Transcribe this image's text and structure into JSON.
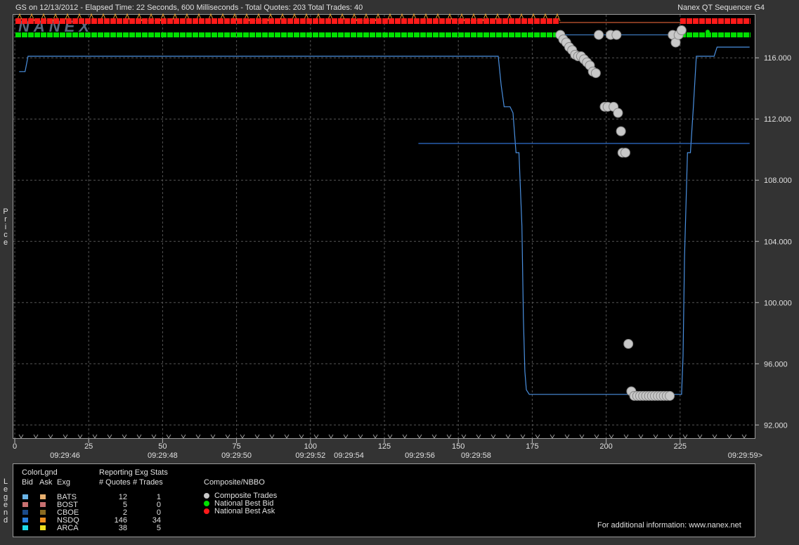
{
  "header": {
    "left_text": "GS on 12/13/2012  -  Elapsed Time: 22 Seconds, 600 Milliseconds  -  Total Quotes: 203  Total Trades: 40",
    "right_text": "Nanex QT Sequencer G4"
  },
  "watermark": "NANEX",
  "y_axis_label": "Price",
  "legend_side_label": "Legend",
  "chart_data": {
    "type": "scatter",
    "title": "",
    "ylim": [
      91.6,
      118.4
    ],
    "xlim": [
      0,
      250
    ],
    "y_ticks": [
      "92.000",
      "96.000",
      "100.000",
      "104.000",
      "108.000",
      "112.000",
      "116.000"
    ],
    "y_tick_values": [
      92,
      96,
      100,
      104,
      108,
      112,
      116
    ],
    "x_ticks": [
      "0",
      "25",
      "50",
      "75",
      "100",
      "125",
      "150",
      "175",
      "200",
      "225"
    ],
    "x_tick_values": [
      0,
      25,
      50,
      75,
      100,
      125,
      150,
      175,
      200,
      225
    ],
    "time_labels": [
      "09:29:46",
      "09:29:48",
      "09:29:50",
      "09:29:52",
      "09:29:54",
      "09:29:56",
      "09:29:58",
      "09:29:59>"
    ],
    "time_label_x": [
      17,
      50,
      75,
      100,
      113,
      137,
      156,
      247
    ],
    "grid": true,
    "series": [
      {
        "name": "Composite Trades",
        "color": "#c8c8c8",
        "points": [
          [
            184.5,
            117.5
          ],
          [
            185.5,
            117.2
          ],
          [
            186.5,
            117.0
          ],
          [
            187.5,
            116.7
          ],
          [
            188.5,
            116.5
          ],
          [
            189.5,
            116.2
          ],
          [
            190.5,
            116.1
          ],
          [
            191.5,
            116.1
          ],
          [
            192.5,
            115.9
          ],
          [
            193.5,
            115.7
          ],
          [
            194.5,
            115.5
          ],
          [
            195.5,
            115.1
          ],
          [
            196.5,
            115.0
          ],
          [
            197.5,
            117.5
          ],
          [
            199.5,
            112.8
          ],
          [
            200.5,
            112.8
          ],
          [
            201.5,
            117.5
          ],
          [
            202.5,
            112.8
          ],
          [
            203.5,
            117.5
          ],
          [
            204,
            112.4
          ],
          [
            205,
            111.2
          ],
          [
            205.5,
            109.8
          ],
          [
            206.5,
            109.8
          ],
          [
            207.5,
            97.3
          ],
          [
            208.5,
            94.2
          ],
          [
            209.5,
            93.9
          ],
          [
            210.5,
            93.9
          ],
          [
            211.5,
            93.9
          ],
          [
            212.5,
            93.9
          ],
          [
            213.5,
            93.9
          ],
          [
            214.5,
            93.9
          ],
          [
            215.5,
            93.9
          ],
          [
            216.5,
            93.9
          ],
          [
            217.5,
            93.9
          ],
          [
            218.5,
            93.9
          ],
          [
            219.5,
            93.9
          ],
          [
            220.5,
            93.9
          ],
          [
            221.5,
            93.9
          ],
          [
            222.5,
            117.5
          ],
          [
            223.5,
            117.0
          ],
          [
            224.5,
            117.5
          ],
          [
            225.5,
            117.8
          ]
        ]
      },
      {
        "name": "Light Blue Bid Line",
        "color": "#4a90e0",
        "line": [
          [
            1.5,
            115.1
          ],
          [
            3.5,
            115.1
          ],
          [
            4.5,
            116.1
          ],
          [
            163.5,
            116.1
          ],
          [
            164.5,
            114.2
          ],
          [
            165.5,
            112.8
          ],
          [
            167.5,
            112.8
          ],
          [
            168.5,
            112.4
          ],
          [
            169.5,
            109.8
          ],
          [
            170.5,
            109.8
          ],
          [
            171.5,
            105.0
          ],
          [
            172,
            99.0
          ],
          [
            172.5,
            95.5
          ],
          [
            173,
            94.3
          ],
          [
            174,
            94.0
          ],
          [
            225.5,
            94.0
          ],
          [
            226,
            96.5
          ],
          [
            226.5,
            103.0
          ],
          [
            227.5,
            109.8
          ],
          [
            228.5,
            109.8
          ],
          [
            229.5,
            112.8
          ],
          [
            230.5,
            116.1
          ],
          [
            236.5,
            116.1
          ],
          [
            237.5,
            116.7
          ],
          [
            248.5,
            116.7
          ]
        ]
      },
      {
        "name": "Mid Line",
        "color": "#2f6fd0",
        "line": [
          [
            136.5,
            110.4
          ],
          [
            248.5,
            110.4
          ]
        ]
      },
      {
        "name": "National Best Bid",
        "color": "#00e000",
        "y": 117.5
      },
      {
        "name": "National Best Ask",
        "color": "#ff1a1a",
        "y": 118.4
      }
    ]
  },
  "legend": {
    "col_headers": {
      "color_legend": "ColorLgnd",
      "bid": "Bid",
      "ask": "Ask",
      "exg": "Exg",
      "stats_title": "Reporting Exg Stats",
      "quotes": "# Quotes",
      "trades": "# Trades",
      "composite": "Composite/NBBO"
    },
    "exchanges": [
      {
        "name": "BATS",
        "quotes": "12",
        "trades": "1",
        "bid_color": "#6ab4e8",
        "ask_color": "#e8b070"
      },
      {
        "name": "BOST",
        "quotes": "5",
        "trades": "0",
        "bid_color": "#c87070",
        "ask_color": "#c87070"
      },
      {
        "name": "CBOE",
        "quotes": "2",
        "trades": "0",
        "bid_color": "#1a4a8a",
        "ask_color": "#8a6a20"
      },
      {
        "name": "NSDQ",
        "quotes": "146",
        "trades": "34",
        "bid_color": "#2a80e0",
        "ask_color": "#f09020"
      },
      {
        "name": "ARCA",
        "quotes": "38",
        "trades": "5",
        "bid_color": "#20d8e8",
        "ask_color": "#f0e020"
      }
    ],
    "composite_items": [
      {
        "label": "Composite Trades",
        "color": "#c8c8c8"
      },
      {
        "label": "National Best Bid",
        "color": "#00e000"
      },
      {
        "label": "National Best Ask",
        "color": "#ff1a1a"
      }
    ],
    "footer": "For additional information: www.nanex.net"
  }
}
